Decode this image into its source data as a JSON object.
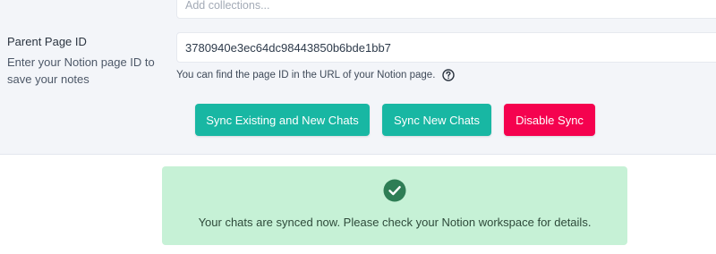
{
  "form": {
    "collections": {
      "placeholder": "Add collections..."
    },
    "parent_page": {
      "label": "Parent Page ID",
      "help": "Enter your Notion page ID to save your notes",
      "value": "3780940e3ec64dc98443850b6bde1bb7",
      "hint": "You can find the page ID in the URL of your Notion page.",
      "hint_icon": "question-circle-icon"
    }
  },
  "actions": {
    "sync_all_label": "Sync Existing and New Chats",
    "sync_new_label": "Sync New Chats",
    "disable_label": "Disable Sync"
  },
  "status": {
    "icon": "check-circle-icon",
    "message": "Your chats are synced now. Please check your Notion workspace for details."
  },
  "colors": {
    "primary": "#18b7a3",
    "danger": "#f5024f",
    "success_bg": "#c6f1d6",
    "success_icon": "#2e7d55",
    "panel_bg": "#f3f5f9"
  }
}
